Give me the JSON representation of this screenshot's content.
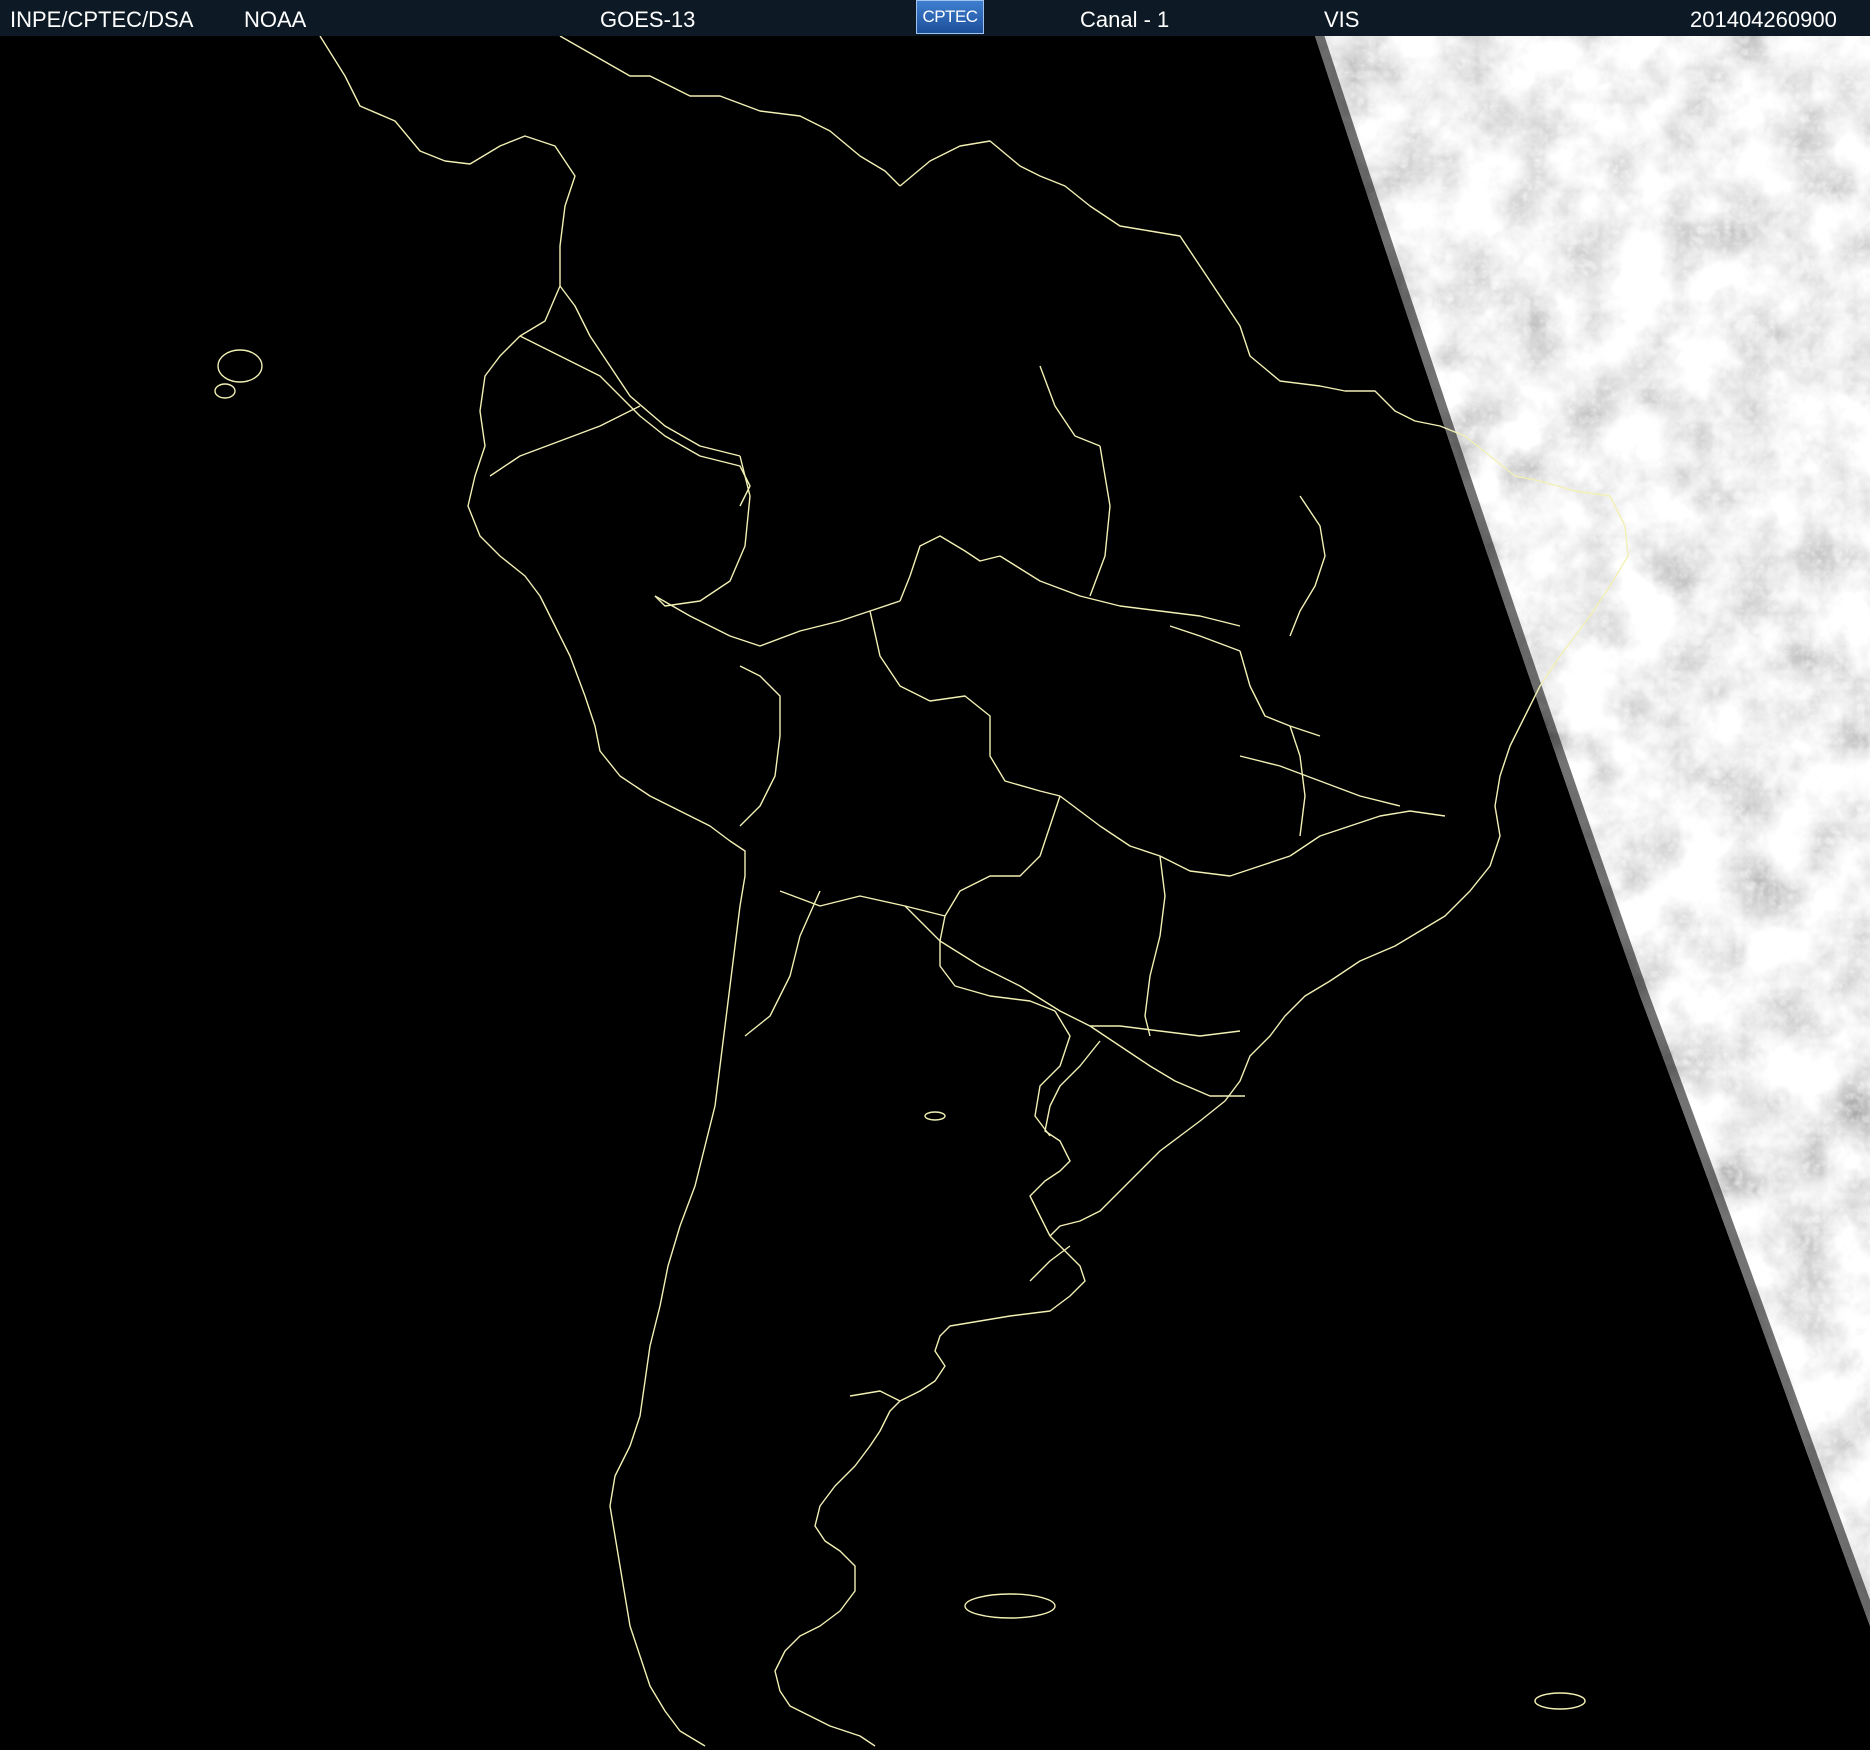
{
  "header": {
    "org": "INPE/CPTEC/DSA",
    "agency": "NOAA",
    "satellite": "GOES-13",
    "logo_text": "CPTEC",
    "channel": "Canal - 1",
    "band": "VIS",
    "timestamp": "201404260900"
  },
  "colors": {
    "header_bg": "#0d1a26",
    "header_text": "#ffffff",
    "space_bg": "#000000",
    "border_lines": "#f2f0b4",
    "cloud_gray": "#8c8c8c"
  },
  "map": {
    "type": "satellite-visible-image",
    "region": "South America",
    "illuminated_side": "east"
  }
}
